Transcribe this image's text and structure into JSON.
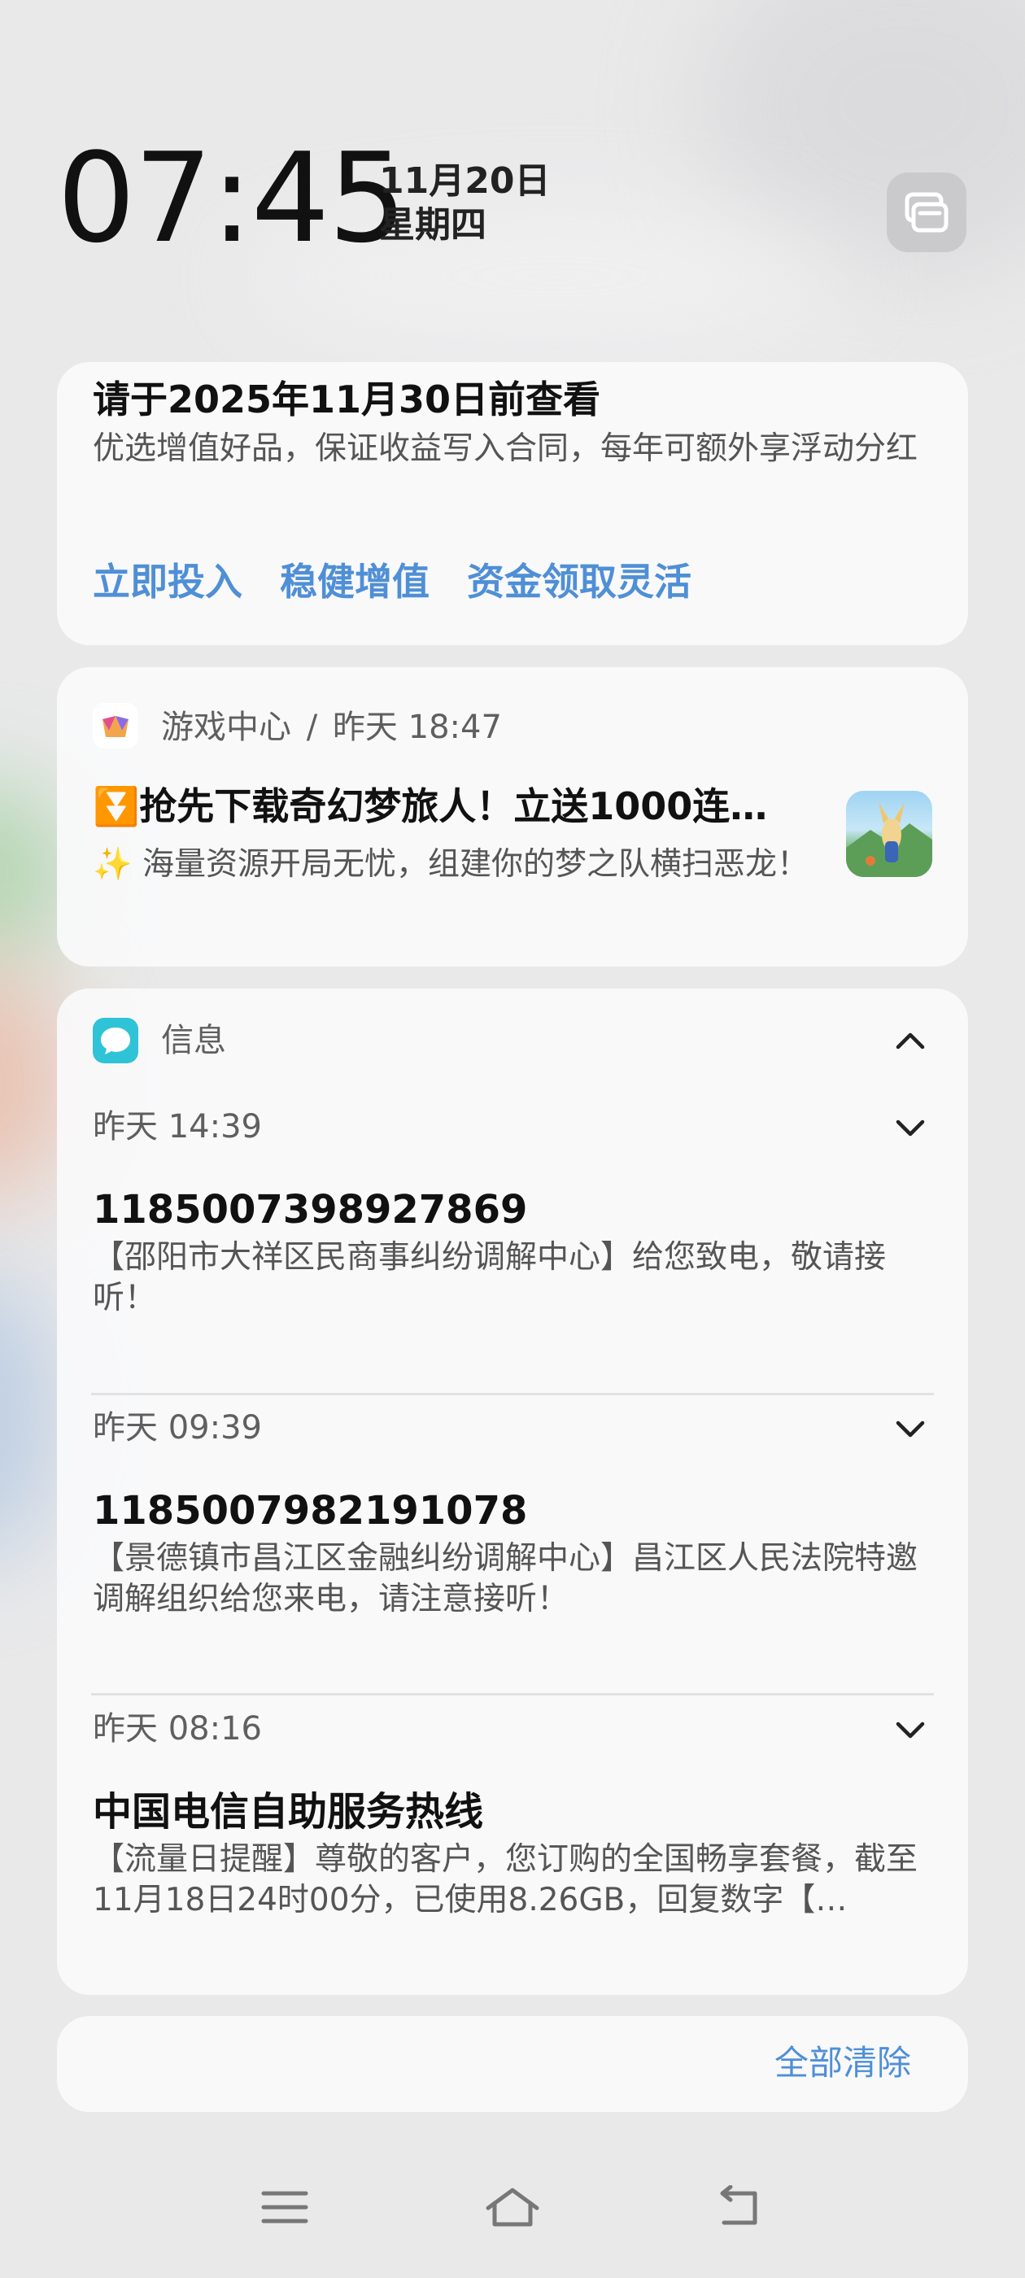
{
  "status": {
    "time": "07:45",
    "date": "11月20日",
    "weekday": "星期四"
  },
  "promo_card": {
    "title": "请于2025年11月30日前查看",
    "body": "优选增值好品，保证收益写入合同，每年可额外享浮动分红",
    "actions": [
      "立即投入",
      "稳健增值",
      "资金领取灵活"
    ]
  },
  "game_card": {
    "app_name": "游戏中心",
    "separator": "/",
    "time": "昨天 18:47",
    "title": "⏬抢先下载奇幻梦旅人！立送1000连…",
    "body": "✨ 海量资源开局无忧，组建你的梦之队横扫恶龙！"
  },
  "messages_card": {
    "app_name": "信息",
    "items": [
      {
        "time": "昨天 14:39",
        "sender": "1185007398927869",
        "text": "【邵阳市大祥区民商事纠纷调解中心】给您致电，敬请接听！"
      },
      {
        "time": "昨天 09:39",
        "sender": "1185007982191078",
        "text": "【景德镇市昌江区金融纠纷调解中心】昌江区人民法院特邀调解组织给您来电，请注意接听！"
      },
      {
        "time": "昨天 08:16",
        "sender": "中国电信自助服务热线",
        "text": "【流量日提醒】尊敬的客户，您订购的全国畅享套餐，截至11月18日24时00分，已使用8.26GB，回复数字【…"
      }
    ]
  },
  "clear_all": "全部清除",
  "icons": {
    "notification_manage": "notification-manage-icon",
    "game_center": "game-center-icon",
    "messages": "messages-icon",
    "collapse": "chevron-up-icon",
    "expand": "chevron-down-icon",
    "nav_menu": "menu-icon",
    "nav_home": "home-icon",
    "nav_back": "back-icon"
  },
  "colors": {
    "accent": "#4f8fd6",
    "messages_icon": "#2fc3d8",
    "card_bg": "#fafafb"
  }
}
